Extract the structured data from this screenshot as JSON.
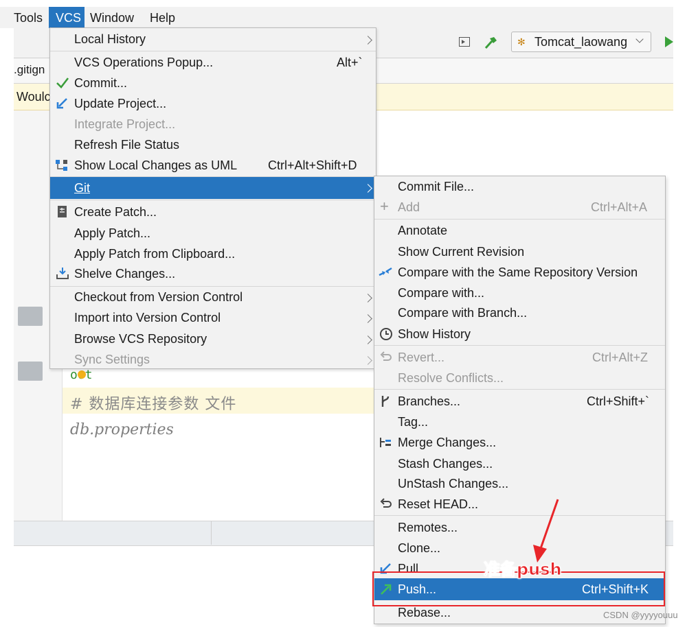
{
  "menubar": {
    "tools": "Tools",
    "vcs": "VCS",
    "window": "Window",
    "help": "Help"
  },
  "toolbar": {
    "run_config": "Tomcat_laowang"
  },
  "editor": {
    "tab": ".gitign",
    "banner": "Woulc",
    "line_oot": "oot",
    "comment": "# 数据库连接参数 文件",
    "filename": "db.properties"
  },
  "vcs_menu": [
    {
      "label": "Local History",
      "submenu": true
    },
    {
      "label": "VCS Operations Popup...",
      "shortcut": "Alt+`"
    },
    {
      "label": "Commit...",
      "icon": "check-icon"
    },
    {
      "label": "Update Project...",
      "icon": "update-arrow-icon"
    },
    {
      "label": "Integrate Project...",
      "disabled": true
    },
    {
      "label": "Refresh File Status"
    },
    {
      "label": "Show Local Changes as UML",
      "shortcut": "Ctrl+Alt+Shift+D",
      "icon": "uml-icon"
    },
    {
      "label": "Git",
      "submenu": true,
      "selected": true
    },
    {
      "label": "Create Patch...",
      "icon": "patch-icon"
    },
    {
      "label": "Apply Patch..."
    },
    {
      "label": "Apply Patch from Clipboard..."
    },
    {
      "label": "Shelve Changes...",
      "icon": "shelve-icon"
    },
    {
      "label": "Checkout from Version Control",
      "submenu": true
    },
    {
      "label": "Import into Version Control",
      "submenu": true
    },
    {
      "label": "Browse VCS Repository",
      "submenu": true
    },
    {
      "label": "Sync Settings",
      "submenu": true,
      "disabled": true
    }
  ],
  "git_menu": [
    {
      "label": "Commit File..."
    },
    {
      "label": "Add",
      "shortcut": "Ctrl+Alt+A",
      "disabled": true,
      "icon": "plus-icon"
    },
    {
      "label": "Annotate"
    },
    {
      "label": "Show Current Revision"
    },
    {
      "label": "Compare with the Same Repository Version",
      "icon": "compare-icon"
    },
    {
      "label": "Compare with..."
    },
    {
      "label": "Compare with Branch..."
    },
    {
      "label": "Show History",
      "icon": "clock-icon"
    },
    {
      "label": "Revert...",
      "shortcut": "Ctrl+Alt+Z",
      "disabled": true,
      "icon": "revert-icon"
    },
    {
      "label": "Resolve Conflicts...",
      "disabled": true
    },
    {
      "label": "Branches...",
      "shortcut": "Ctrl+Shift+`",
      "icon": "branch-icon"
    },
    {
      "label": "Tag..."
    },
    {
      "label": "Merge Changes...",
      "icon": "merge-icon"
    },
    {
      "label": "Stash Changes..."
    },
    {
      "label": "UnStash Changes..."
    },
    {
      "label": "Reset HEAD...",
      "icon": "reset-icon"
    },
    {
      "label": "Remotes..."
    },
    {
      "label": "Clone..."
    },
    {
      "label": "Pull...",
      "icon": "pull-icon"
    },
    {
      "label": "Push...",
      "shortcut": "Ctrl+Shift+K",
      "selected": true,
      "icon": "push-icon"
    },
    {
      "label": "Rebase..."
    }
  ],
  "annotation": {
    "text": "准备push",
    "color": "#e8262a"
  },
  "watermark": "CSDN @yyyyouuu",
  "colors": {
    "selection": "#2675bf",
    "banner": "#fdf8dc",
    "accent_green": "#3a9d3a"
  }
}
